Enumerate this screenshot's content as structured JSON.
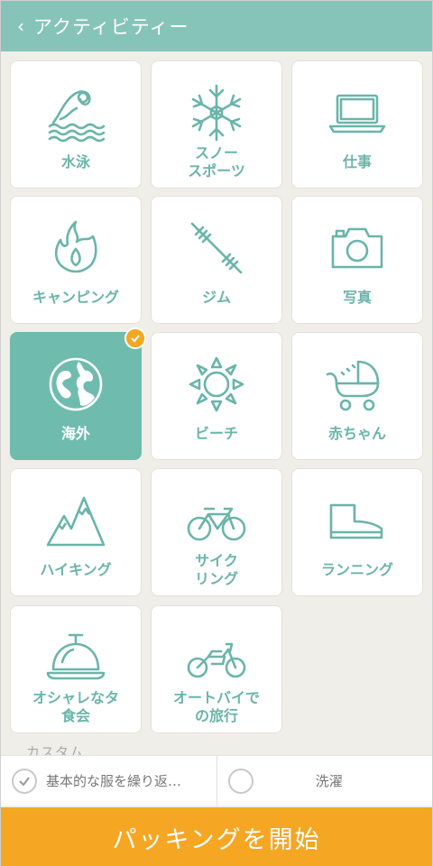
{
  "header": {
    "title": "アクティビティー"
  },
  "activities": [
    {
      "label": "水泳",
      "icon": "swimming-icon",
      "selected": false
    },
    {
      "label": "スノー\nスポーツ",
      "icon": "snowflake-icon",
      "selected": false
    },
    {
      "label": "仕事",
      "icon": "laptop-icon",
      "selected": false
    },
    {
      "label": "キャンピング",
      "icon": "campfire-icon",
      "selected": false
    },
    {
      "label": "ジム",
      "icon": "barbell-icon",
      "selected": false
    },
    {
      "label": "写真",
      "icon": "camera-icon",
      "selected": false
    },
    {
      "label": "海外",
      "icon": "globe-icon",
      "selected": true
    },
    {
      "label": "ビーチ",
      "icon": "sun-icon",
      "selected": false
    },
    {
      "label": "赤ちゃん",
      "icon": "stroller-icon",
      "selected": false
    },
    {
      "label": "ハイキング",
      "icon": "mountain-icon",
      "selected": false
    },
    {
      "label": "サイク\nリング",
      "icon": "bicycle-icon",
      "selected": false
    },
    {
      "label": "ランニング",
      "icon": "shoe-icon",
      "selected": false
    },
    {
      "label": "オシャレなタ\n食会",
      "icon": "cloche-icon",
      "selected": false
    },
    {
      "label": "オートバイで\nの旅行",
      "icon": "motorcycle-icon",
      "selected": false
    }
  ],
  "custom": {
    "label": "カスタム",
    "items": [
      {
        "label": "基本的な服を繰り返…",
        "checked": true
      },
      {
        "label": "洗濯",
        "checked": false
      }
    ]
  },
  "start_button": "パッキングを開始",
  "colors": {
    "accent": "#86c4ba",
    "selected_tile": "#6fbcaf",
    "orange": "#f5a623",
    "icon": "#6ab5aa"
  }
}
